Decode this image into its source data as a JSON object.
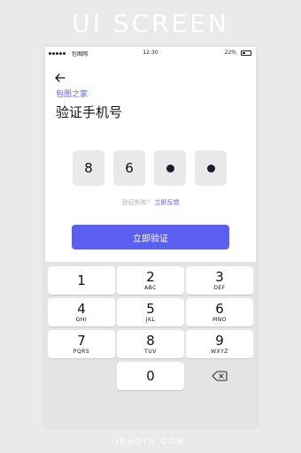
{
  "banner": "UI SCREEN",
  "footer": "IBAOTU.COM",
  "status_bar": {
    "carrier": "包图网",
    "time": "12:30",
    "battery_percent": "22%"
  },
  "header": {
    "back_icon": "arrow-left-icon",
    "brand": "包图之家",
    "title": "验证手机号"
  },
  "code": {
    "digits": [
      "8",
      "6"
    ],
    "hidden_count": 2
  },
  "hint": {
    "text": "验证失败？",
    "link": "立即反馈"
  },
  "verify_button": "立即验证",
  "keypad": {
    "keys": [
      {
        "num": "1",
        "letters": ""
      },
      {
        "num": "2",
        "letters": "ABC"
      },
      {
        "num": "3",
        "letters": "DEF"
      },
      {
        "num": "4",
        "letters": "GHI"
      },
      {
        "num": "5",
        "letters": "JKL"
      },
      {
        "num": "6",
        "letters": "MNO"
      },
      {
        "num": "7",
        "letters": "PQRS"
      },
      {
        "num": "8",
        "letters": "TUV"
      },
      {
        "num": "9",
        "letters": "WXYZ"
      },
      {
        "num": "0",
        "letters": ""
      }
    ],
    "delete_icon": "backspace-icon"
  },
  "colors": {
    "accent": "#5b5ff0",
    "keypad_bg": "#e4e4e4",
    "code_box_bg": "#e9e9e9"
  }
}
